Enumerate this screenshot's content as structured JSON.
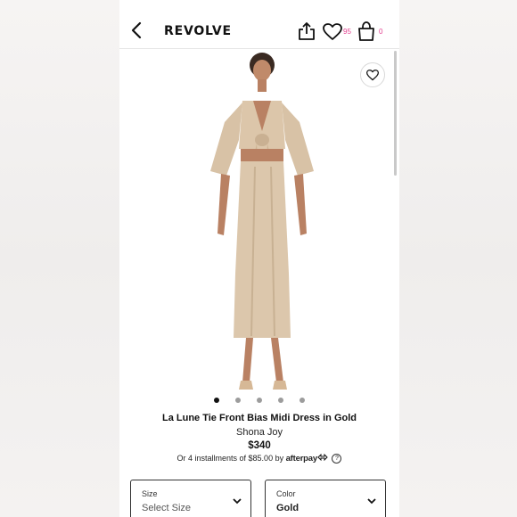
{
  "header": {
    "brand": "REVOLVE",
    "wishlist_count": "95",
    "bag_count": "0"
  },
  "gallery": {
    "image_count": 5,
    "active_index": 0
  },
  "product": {
    "name": "La Lune Tie Front Bias Midi Dress in Gold",
    "brand": "Shona Joy",
    "price": "$340",
    "installments_text": "Or 4 installments of $85.00 by",
    "installments_provider": "afterpay",
    "help_symbol": "?"
  },
  "options": {
    "size_label": "Size",
    "size_value": "Select Size",
    "color_label": "Color",
    "color_value": "Gold"
  },
  "colors": {
    "accent": "#e23f8f",
    "dress": "#d8c2a6"
  },
  "icons": [
    "back-arrow-icon",
    "share-icon",
    "heart-icon",
    "bag-icon",
    "chevron-down-icon",
    "question-icon"
  ]
}
